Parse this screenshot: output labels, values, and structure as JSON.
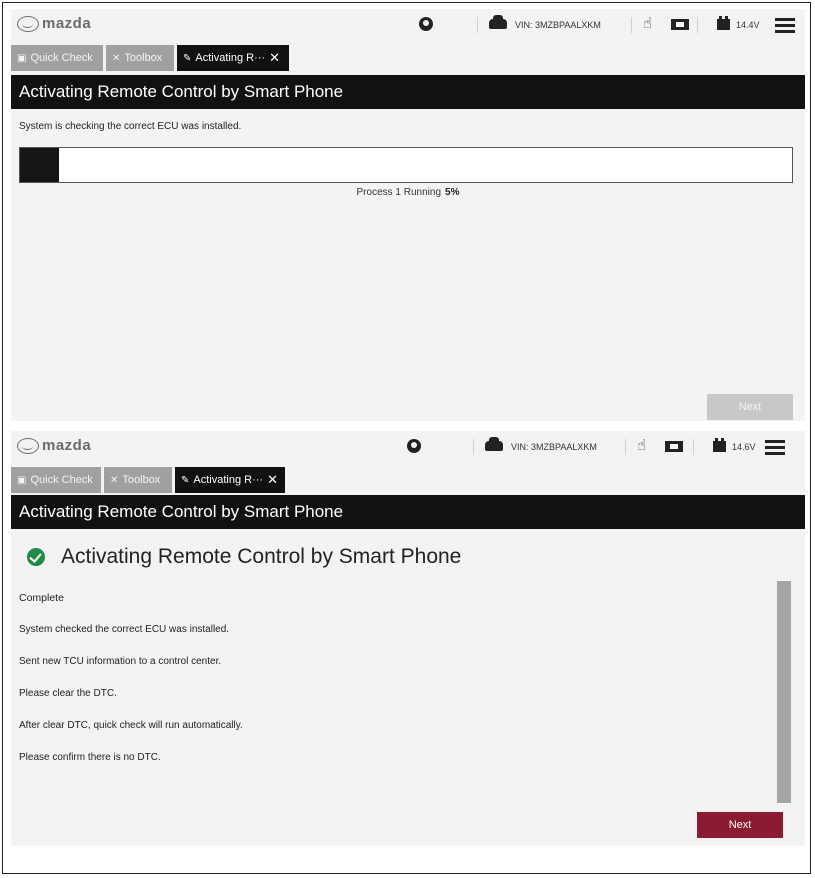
{
  "brand": {
    "logo_text": "mazda"
  },
  "status_bar_1": {
    "vin": "VIN: 3MZBPAALXKM",
    "voltage": "14.4V"
  },
  "status_bar_2": {
    "vin": "VIN: 3MZBPAALXKM",
    "voltage": "14.6V"
  },
  "tabs": {
    "quick_check": "Quick Check",
    "toolbox": "Toolbox",
    "active": "Activating R···",
    "close_glyph": "✕"
  },
  "screen1": {
    "title": "Activating Remote Control by Smart Phone",
    "status_message": "System is checking the correct ECU was installed.",
    "progress_label": "Process 1 Running",
    "progress_percent_text": "5%",
    "progress_value": 0.05,
    "next_label": "Next"
  },
  "screen2": {
    "title": "Activating Remote Control by Smart Phone",
    "heading": "Activating Remote Control by Smart Phone",
    "messages": [
      "Complete",
      "System checked the correct ECU was installed.",
      "Sent new TCU information to a control center.",
      "Please clear the DTC.",
      "After clear DTC, quick check will run automatically.",
      "Please confirm there is no DTC."
    ],
    "next_label": "Next"
  },
  "colors": {
    "title_bar": "#111111",
    "tab_inactive": "#a0a0a0",
    "next_enabled": "#8b1a33",
    "next_disabled": "#c8c8c8",
    "success": "#1e8b46"
  },
  "icons": [
    "mazda-logo",
    "user-icon",
    "car-icon",
    "hand-icon",
    "ecu-icon",
    "battery-icon",
    "menu-icon",
    "briefcase-icon",
    "tools-icon",
    "wrench-icon",
    "close-icon",
    "check-circle-icon"
  ]
}
